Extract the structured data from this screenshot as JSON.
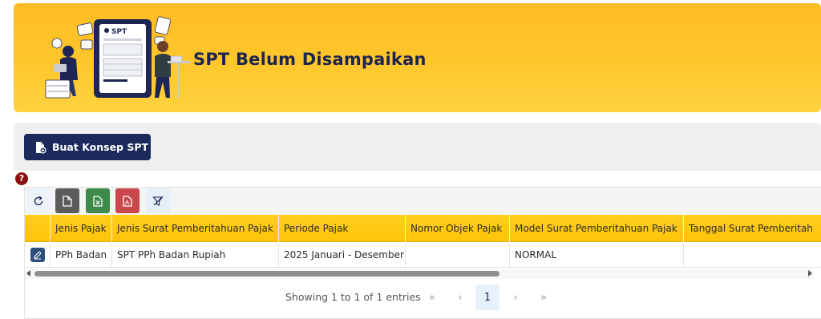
{
  "hero": {
    "title": "SPT Belum Disampaikan",
    "illustration": {
      "badge_text": "SPT"
    }
  },
  "actions": {
    "create_label": "Buat Konsep SPT"
  },
  "help": {
    "glyph": "?"
  },
  "grid_tools": {
    "icons": [
      "refresh-icon",
      "file-icon",
      "excel-icon",
      "pdf-icon",
      "filter-clear-icon"
    ]
  },
  "table": {
    "columns": [
      "",
      "Jenis Pajak",
      "Jenis Surat Pemberitahuan Pajak",
      "Periode Pajak",
      "Nomor Objek Pajak",
      "Model Surat Pemberitahuan Pajak",
      "Tanggal Surat Pemberitah"
    ],
    "rows": [
      {
        "jenis_pajak": "PPh Badan",
        "jenis_spt": "SPT PPh Badan Rupiah",
        "periode": "2025 Januari - Desember",
        "nop": "",
        "model": "NORMAL",
        "tanggal": ""
      }
    ]
  },
  "pagination": {
    "info": "Showing 1 to 1 of 1 entries",
    "first": "«",
    "prev": "‹",
    "current": "1",
    "next": "›",
    "last": "»"
  },
  "colors": {
    "hero_yellow": "#ffc82e",
    "header_yellow": "#ffc30a",
    "navy": "#1b2a5a",
    "excel_green": "#3e8a4b",
    "pdf_red": "#c9484b",
    "help_red": "#8b0f0f"
  }
}
